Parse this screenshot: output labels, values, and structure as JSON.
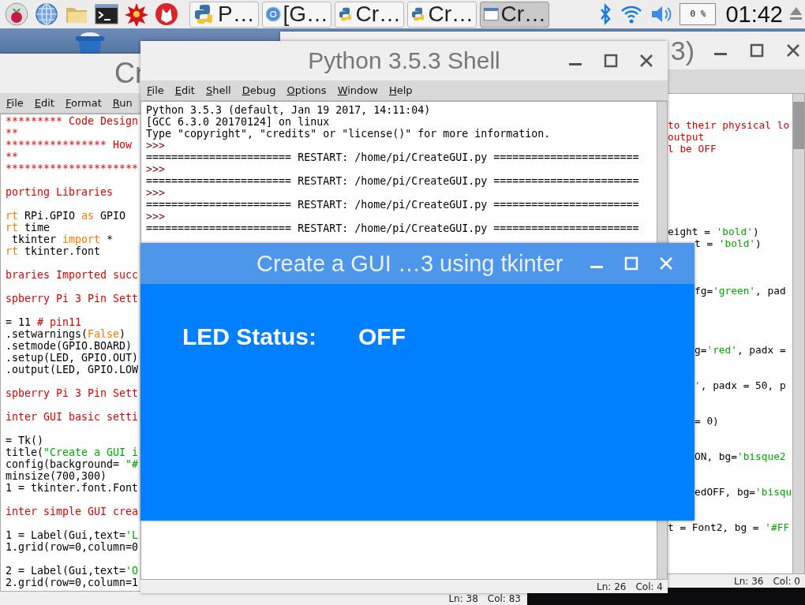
{
  "taskbar": {
    "tasks": [
      {
        "label": "P…",
        "kind": "python",
        "selected": false
      },
      {
        "label": "[G…",
        "kind": "browser",
        "selected": false
      },
      {
        "label": "Cr…",
        "kind": "python",
        "selected": false
      },
      {
        "label": "Cr…",
        "kind": "python",
        "selected": false
      },
      {
        "label": "Cr…",
        "kind": "window",
        "selected": true
      }
    ],
    "cpu": "0 %",
    "clock": "01:42"
  },
  "left_editor": {
    "title": "Cr",
    "menu": [
      "File",
      "Edit",
      "Format",
      "Run"
    ],
    "lines": [
      {
        "kind": "code",
        "segments": [
          {
            "kind": "comment",
            "text": "********* Code Design"
          }
        ]
      },
      {
        "kind": "code",
        "segments": [
          {
            "kind": "comment",
            "text": "**"
          }
        ]
      },
      {
        "kind": "code",
        "segments": [
          {
            "kind": "comment",
            "text": "**************** How"
          }
        ]
      },
      {
        "kind": "code",
        "segments": [
          {
            "kind": "comment",
            "text": "**"
          }
        ]
      },
      {
        "kind": "code",
        "segments": [
          {
            "kind": "comment",
            "text": "*********************"
          }
        ]
      },
      {
        "kind": "blank"
      },
      {
        "kind": "code",
        "segments": [
          {
            "kind": "comment",
            "text": "porting Libraries"
          }
        ]
      },
      {
        "kind": "blank"
      },
      {
        "kind": "code",
        "segments": [
          {
            "kind": "keyword",
            "text": "rt"
          },
          {
            "kind": "plain",
            "text": " RPi.GPIO "
          },
          {
            "kind": "keyword",
            "text": "as"
          },
          {
            "kind": "plain",
            "text": " GPIO"
          }
        ]
      },
      {
        "kind": "code",
        "segments": [
          {
            "kind": "keyword",
            "text": "rt"
          },
          {
            "kind": "plain",
            "text": " time"
          }
        ]
      },
      {
        "kind": "code",
        "segments": [
          {
            "kind": "plain",
            "text": " tkinter "
          },
          {
            "kind": "keyword",
            "text": "import"
          },
          {
            "kind": "plain",
            "text": " *"
          }
        ]
      },
      {
        "kind": "code",
        "segments": [
          {
            "kind": "keyword",
            "text": "rt"
          },
          {
            "kind": "plain",
            "text": " tkinter.font"
          }
        ]
      },
      {
        "kind": "blank"
      },
      {
        "kind": "code",
        "segments": [
          {
            "kind": "comment",
            "text": "braries Imported succ"
          }
        ]
      },
      {
        "kind": "blank"
      },
      {
        "kind": "code",
        "segments": [
          {
            "kind": "comment",
            "text": "spberry Pi 3 Pin Sett"
          }
        ]
      },
      {
        "kind": "blank"
      },
      {
        "kind": "code",
        "segments": [
          {
            "kind": "plain",
            "text": "= 11 "
          },
          {
            "kind": "comment",
            "text": "# pin11"
          }
        ]
      },
      {
        "kind": "code",
        "segments": [
          {
            "kind": "plain",
            "text": ".setwarnings("
          },
          {
            "kind": "keyword",
            "text": "False"
          },
          {
            "kind": "plain",
            "text": ")"
          }
        ]
      },
      {
        "kind": "code",
        "segments": [
          {
            "kind": "plain",
            "text": ".setmode(GPIO.BOARD)"
          }
        ]
      },
      {
        "kind": "code",
        "segments": [
          {
            "kind": "plain",
            "text": ".setup(LED, GPIO.OUT)"
          }
        ]
      },
      {
        "kind": "code",
        "segments": [
          {
            "kind": "plain",
            "text": ".output(LED, GPIO.LOW"
          }
        ]
      },
      {
        "kind": "blank"
      },
      {
        "kind": "code",
        "segments": [
          {
            "kind": "comment",
            "text": "spberry Pi 3 Pin Sett"
          }
        ]
      },
      {
        "kind": "blank"
      },
      {
        "kind": "code",
        "segments": [
          {
            "kind": "comment",
            "text": "inter GUI basic setti"
          }
        ]
      },
      {
        "kind": "blank"
      },
      {
        "kind": "code",
        "segments": [
          {
            "kind": "plain",
            "text": "= Tk()"
          }
        ]
      },
      {
        "kind": "code",
        "segments": [
          {
            "kind": "plain",
            "text": "title("
          },
          {
            "kind": "string",
            "text": "\"Create a GUI i"
          }
        ]
      },
      {
        "kind": "code",
        "segments": [
          {
            "kind": "plain",
            "text": "config(background= "
          },
          {
            "kind": "string",
            "text": "\"#"
          }
        ]
      },
      {
        "kind": "code",
        "segments": [
          {
            "kind": "plain",
            "text": "minsize(700,300)"
          }
        ]
      },
      {
        "kind": "code",
        "segments": [
          {
            "kind": "plain",
            "text": "1 = tkinter.font.Font"
          }
        ]
      },
      {
        "kind": "blank"
      },
      {
        "kind": "code",
        "segments": [
          {
            "kind": "comment",
            "text": "inter simple GUI crea"
          }
        ]
      },
      {
        "kind": "blank"
      },
      {
        "kind": "code",
        "segments": [
          {
            "kind": "plain",
            "text": "1 = Label(Gui,text="
          },
          {
            "kind": "string",
            "text": "'L"
          }
        ]
      },
      {
        "kind": "code",
        "segments": [
          {
            "kind": "plain",
            "text": "1.grid(row=0,column=0"
          }
        ]
      },
      {
        "kind": "blank"
      },
      {
        "kind": "code",
        "segments": [
          {
            "kind": "plain",
            "text": "2 = Label(Gui,text="
          },
          {
            "kind": "string",
            "text": "'O"
          }
        ]
      },
      {
        "kind": "code",
        "segments": [
          {
            "kind": "plain",
            "text": "2.grid(row=0,column=1"
          }
        ]
      }
    ],
    "status": {
      "line": "Ln: 38",
      "column": "Col: 83"
    }
  },
  "right_editor": {
    "title": "3)",
    "lines": [
      {
        "kind": "blank"
      },
      {
        "kind": "blank"
      },
      {
        "kind": "code",
        "segments": [
          {
            "kind": "comment",
            "text": "to their physical lo"
          }
        ]
      },
      {
        "kind": "code",
        "segments": [
          {
            "kind": "comment",
            "text": "output"
          }
        ]
      },
      {
        "kind": "code",
        "segments": [
          {
            "kind": "comment",
            "text": "l be OFF"
          }
        ]
      },
      {
        "kind": "blank"
      },
      {
        "kind": "blank"
      },
      {
        "kind": "blank"
      },
      {
        "kind": "blank"
      },
      {
        "kind": "blank"
      },
      {
        "kind": "blank"
      },
      {
        "kind": "code",
        "segments": [
          {
            "kind": "plain",
            "text": "eight = "
          },
          {
            "kind": "string",
            "text": "'bold'"
          },
          {
            "kind": "plain",
            "text": ")"
          }
        ]
      },
      {
        "kind": "code",
        "segments": [
          {
            "kind": "plain",
            "text": "t = "
          },
          {
            "kind": "string",
            "text": "'bold'"
          },
          {
            "kind": "plain",
            "text": ")"
          }
        ]
      },
      {
        "kind": "blank"
      },
      {
        "kind": "blank"
      },
      {
        "kind": "blank"
      },
      {
        "kind": "code",
        "segments": [
          {
            "kind": "plain",
            "text": "fg="
          },
          {
            "kind": "string",
            "text": "'green'"
          },
          {
            "kind": "plain",
            "text": ", pad"
          }
        ]
      },
      {
        "kind": "blank"
      },
      {
        "kind": "blank"
      },
      {
        "kind": "blank"
      },
      {
        "kind": "blank"
      },
      {
        "kind": "code",
        "segments": [
          {
            "kind": "plain",
            "text": "g="
          },
          {
            "kind": "string",
            "text": "'red'"
          },
          {
            "kind": "plain",
            "text": ", padx ="
          }
        ]
      },
      {
        "kind": "blank"
      },
      {
        "kind": "blank"
      },
      {
        "kind": "code",
        "segments": [
          {
            "kind": "string",
            "text": "'"
          },
          {
            "kind": "plain",
            "text": ", padx = 50, p"
          }
        ]
      },
      {
        "kind": "blank"
      },
      {
        "kind": "blank"
      },
      {
        "kind": "code",
        "segments": [
          {
            "kind": "plain",
            "text": "= 0)"
          }
        ]
      },
      {
        "kind": "blank"
      },
      {
        "kind": "blank"
      },
      {
        "kind": "code",
        "segments": [
          {
            "kind": "plain",
            "text": "ON, bg="
          },
          {
            "kind": "string",
            "text": "'bisque2"
          }
        ]
      },
      {
        "kind": "blank"
      },
      {
        "kind": "blank"
      },
      {
        "kind": "code",
        "segments": [
          {
            "kind": "plain",
            "text": "edOFF, bg="
          },
          {
            "kind": "string",
            "text": "'bisqu"
          }
        ]
      },
      {
        "kind": "blank"
      },
      {
        "kind": "blank"
      },
      {
        "kind": "code",
        "segments": [
          {
            "kind": "plain",
            "text": "t = Font2, bg = "
          },
          {
            "kind": "string",
            "text": "'#FF"
          }
        ]
      }
    ],
    "status": {
      "line": "Ln: 36",
      "column": "Col: 0"
    }
  },
  "shell": {
    "title": "Python 3.5.3 Shell",
    "menu": [
      "File",
      "Edit",
      "Shell",
      "Debug",
      "Options",
      "Window",
      "Help"
    ],
    "lines": [
      {
        "kind": "code",
        "segments": [
          {
            "kind": "plain",
            "text": "Python 3.5.3 (default, Jan 19 2017, 14:11:04)"
          }
        ]
      },
      {
        "kind": "code",
        "segments": [
          {
            "kind": "plain",
            "text": "[GCC 6.3.0 20170124] on linux"
          }
        ]
      },
      {
        "kind": "code",
        "segments": [
          {
            "kind": "plain",
            "text": "Type \"copyright\", \"credits\" or \"license()\" for more information."
          }
        ]
      },
      {
        "kind": "code",
        "segments": [
          {
            "kind": "prompt",
            "text": ">>>"
          }
        ]
      },
      {
        "kind": "code",
        "segments": [
          {
            "kind": "plain",
            "text": "======================= RESTART: /home/pi/CreateGUI.py ======================="
          }
        ]
      },
      {
        "kind": "code",
        "segments": [
          {
            "kind": "prompt",
            "text": ">>>"
          }
        ]
      },
      {
        "kind": "code",
        "segments": [
          {
            "kind": "plain",
            "text": "======================= RESTART: /home/pi/CreateGUI.py ======================="
          }
        ]
      },
      {
        "kind": "code",
        "segments": [
          {
            "kind": "prompt",
            "text": ">>>"
          }
        ]
      },
      {
        "kind": "code",
        "segments": [
          {
            "kind": "plain",
            "text": "======================= RESTART: /home/pi/CreateGUI.py ======================="
          }
        ]
      },
      {
        "kind": "code",
        "segments": [
          {
            "kind": "prompt",
            "text": ">>>"
          }
        ]
      },
      {
        "kind": "code",
        "segments": [
          {
            "kind": "plain",
            "text": "======================= RESTART: /home/pi/CreateGUI.py ======================="
          }
        ]
      }
    ],
    "status": {
      "line": "Ln: 26",
      "column": "Col: 4"
    }
  },
  "gui_window": {
    "title": "Create a GUI …3 using tkinter",
    "label": "LED Status:",
    "value": "OFF"
  }
}
